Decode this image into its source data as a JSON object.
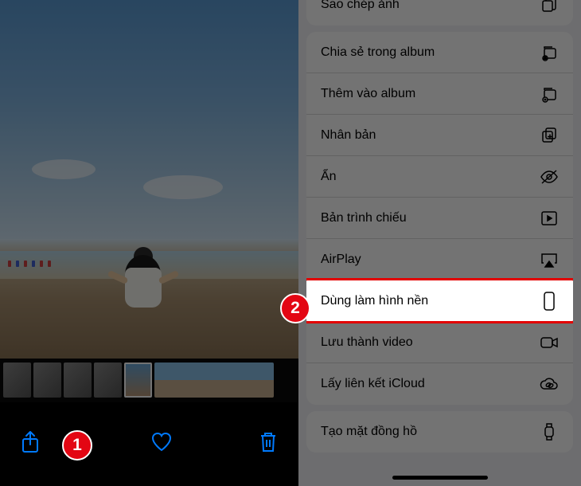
{
  "toolbar": {
    "share_icon": "share-icon",
    "heart_icon": "heart-icon",
    "trash_icon": "trash-icon"
  },
  "badges": {
    "one": "1",
    "two": "2"
  },
  "menu": {
    "group1": [
      {
        "label": "Sao chép ảnh",
        "icon": "copy-icon"
      }
    ],
    "group2": [
      {
        "label": "Chia sẻ trong album",
        "icon": "album-share-icon"
      },
      {
        "label": "Thêm vào album",
        "icon": "album-add-icon"
      },
      {
        "label": "Nhân bản",
        "icon": "duplicate-icon"
      },
      {
        "label": "Ẩn",
        "icon": "hide-icon"
      },
      {
        "label": "Bản trình chiếu",
        "icon": "slideshow-icon"
      },
      {
        "label": "AirPlay",
        "icon": "airplay-icon"
      },
      {
        "label": "Dùng làm hình nền",
        "icon": "wallpaper-icon"
      },
      {
        "label": "Lưu thành video",
        "icon": "video-icon"
      },
      {
        "label": "Lấy liên kết iCloud",
        "icon": "icloud-icon"
      }
    ],
    "group3": [
      {
        "label": "Tạo mặt đồng hồ",
        "icon": "watch-icon"
      }
    ]
  }
}
